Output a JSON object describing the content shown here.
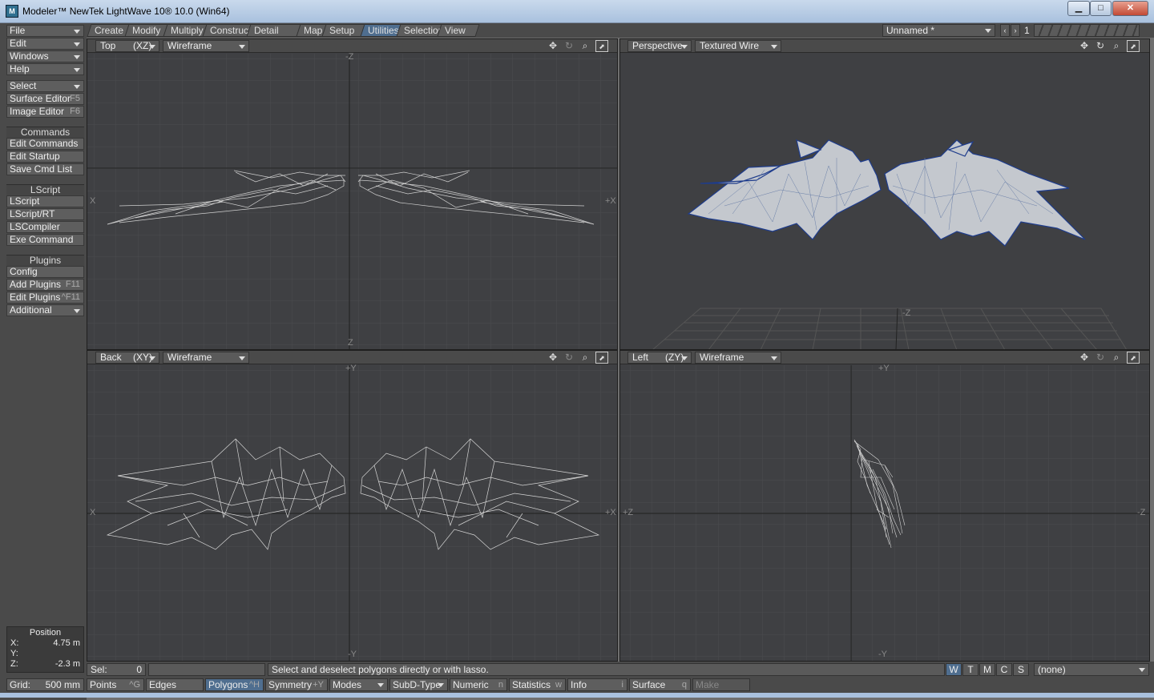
{
  "window": {
    "title": "Modeler™ NewTek LightWave 10® 10.0 (Win64)",
    "icon": "lw-icon"
  },
  "tabs": [
    "Create",
    "Modify",
    "Multiply",
    "Construct",
    "Detail",
    "Map",
    "Setup",
    "Utilities",
    "Selection",
    "View"
  ],
  "active_tab": "Utilities",
  "scene": {
    "name": "Unnamed *",
    "layer": "1"
  },
  "sidebar": {
    "top": [
      {
        "label": "File",
        "dropdown": true
      },
      {
        "label": "Edit",
        "dropdown": true
      },
      {
        "label": "Windows",
        "dropdown": true
      },
      {
        "label": "Help",
        "dropdown": true
      }
    ],
    "mid": [
      {
        "label": "Select",
        "dropdown": true
      },
      {
        "label": "Surface Editor",
        "key": "F5"
      },
      {
        "label": "Image Editor",
        "key": "F6"
      }
    ],
    "commands_header": "Commands",
    "commands": [
      {
        "label": "Edit Commands"
      },
      {
        "label": "Edit Startup"
      },
      {
        "label": "Save Cmd List"
      }
    ],
    "lscript_header": "LScript",
    "lscript": [
      {
        "label": "LScript"
      },
      {
        "label": "LScript/RT"
      },
      {
        "label": "LSCompiler"
      },
      {
        "label": "Exe Command"
      }
    ],
    "plugins_header": "Plugins",
    "plugins": [
      {
        "label": "Config"
      },
      {
        "label": "Add Plugins",
        "key": "F11"
      },
      {
        "label": "Edit Plugins",
        "key": "^F11"
      },
      {
        "label": "Additional",
        "dropdown": true
      }
    ],
    "position": {
      "header": "Position",
      "x_label": "X:",
      "x": "4.75 m",
      "y_label": "Y:",
      "y": "",
      "z_label": "Z:",
      "z": "-2.3 m"
    }
  },
  "viewports": {
    "top": {
      "view": "Top",
      "axes": "(XZ)",
      "mode": "Wireframe",
      "labels": {
        "n": "-Z",
        "s": "Z",
        "w": "X",
        "e": "+X"
      }
    },
    "persp": {
      "view": "Perspective",
      "mode": "Textured Wire",
      "labels": {
        "z": "-Z"
      }
    },
    "back": {
      "view": "Back",
      "axes": "(XY)",
      "mode": "Wireframe",
      "labels": {
        "n": "+Y",
        "s": "-Y",
        "w": "X",
        "e": "+X"
      }
    },
    "left": {
      "view": "Left",
      "axes": "(ZY)",
      "mode": "Wireframe",
      "labels": {
        "n": "+Y",
        "s": "-Y",
        "w": "+Z",
        "e": "-Z"
      }
    }
  },
  "status": {
    "sel_label": "Sel:",
    "sel_value": "0",
    "message": "Select and deselect polygons directly or with lasso.",
    "wtmcs": [
      "W",
      "T",
      "M",
      "C",
      "S"
    ],
    "active_wtmcs": "W",
    "surface": "(none)"
  },
  "bottom": {
    "grid_label": "Grid:",
    "grid_value": "500 mm",
    "buttons": [
      {
        "label": "Points",
        "key": "^G"
      },
      {
        "label": "Edges",
        "key": ""
      },
      {
        "label": "Polygons",
        "key": "^H",
        "active": true
      },
      {
        "label": "Symmetry",
        "key": "+Y"
      },
      {
        "label": "Modes",
        "key": "",
        "dropdown": true
      },
      {
        "label": "SubD-Type",
        "key": "",
        "dropdown": true
      },
      {
        "label": "Numeric",
        "key": "n"
      },
      {
        "label": "Statistics",
        "key": "w"
      },
      {
        "label": "Info",
        "key": "i"
      },
      {
        "label": "Surface",
        "key": "q"
      },
      {
        "label": "Make",
        "key": "",
        "dim": true
      }
    ]
  },
  "colors": {
    "viewport_bg": "#3f4043",
    "grid": "#4b4c4f",
    "wire": "#d8d8d8",
    "mesh_fill": "#c4c8ce",
    "mesh_edge": "#1e3c8c",
    "active_tab": "#4f6e8f"
  }
}
